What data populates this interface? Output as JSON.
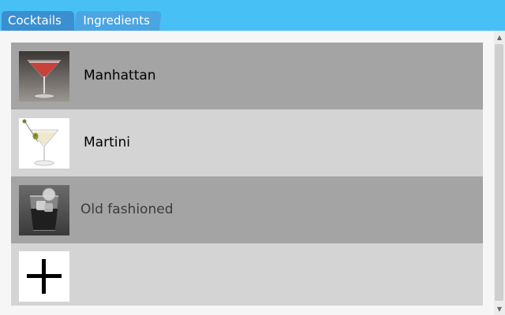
{
  "tabs": [
    {
      "label": "Cocktails"
    },
    {
      "label": "Ingredients"
    }
  ],
  "cocktails": [
    {
      "name": "Manhattan",
      "image": "manhattan-cocktail-glass"
    },
    {
      "name": "Martini",
      "image": "martini-glass-with-olive"
    },
    {
      "name": "Old fashioned",
      "image": "old-fashioned-rocks-glass"
    }
  ],
  "add_item": {
    "icon": "plus-icon"
  },
  "colors": {
    "tabbar": "#47c1f5",
    "tab_active": "#3a8fd0",
    "row_dark": "#a4a4a4",
    "row_light": "#d4d4d4"
  }
}
